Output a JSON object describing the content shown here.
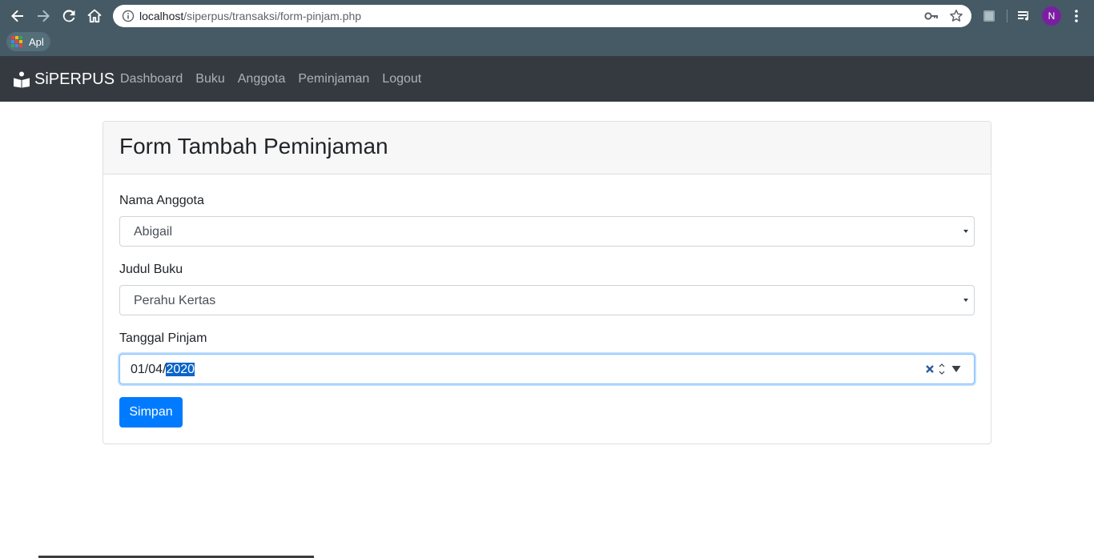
{
  "browser": {
    "url_host": "localhost",
    "url_path": "/siperpus/transaksi/form-pinjam.php",
    "profile_initial": "N",
    "bookmarks": [
      {
        "label": "Apl"
      }
    ]
  },
  "navbar": {
    "brand": "SiPERPUS",
    "links": [
      "Dashboard",
      "Buku",
      "Anggota",
      "Peminjaman",
      "Logout"
    ]
  },
  "form": {
    "title": "Form Tambah Peminjaman",
    "nama_anggota": {
      "label": "Nama Anggota",
      "value": "Abigail"
    },
    "judul_buku": {
      "label": "Judul Buku",
      "value": "Perahu Kertas"
    },
    "tanggal_pinjam": {
      "label": "Tanggal Pinjam",
      "value_prefix": "01/04/",
      "value_selected": "2020"
    },
    "submit_label": "Simpan"
  },
  "colors": {
    "chrome": "#455a64",
    "navbar": "#343a40",
    "primary": "#007bff",
    "profile": "#7b1fa2"
  }
}
